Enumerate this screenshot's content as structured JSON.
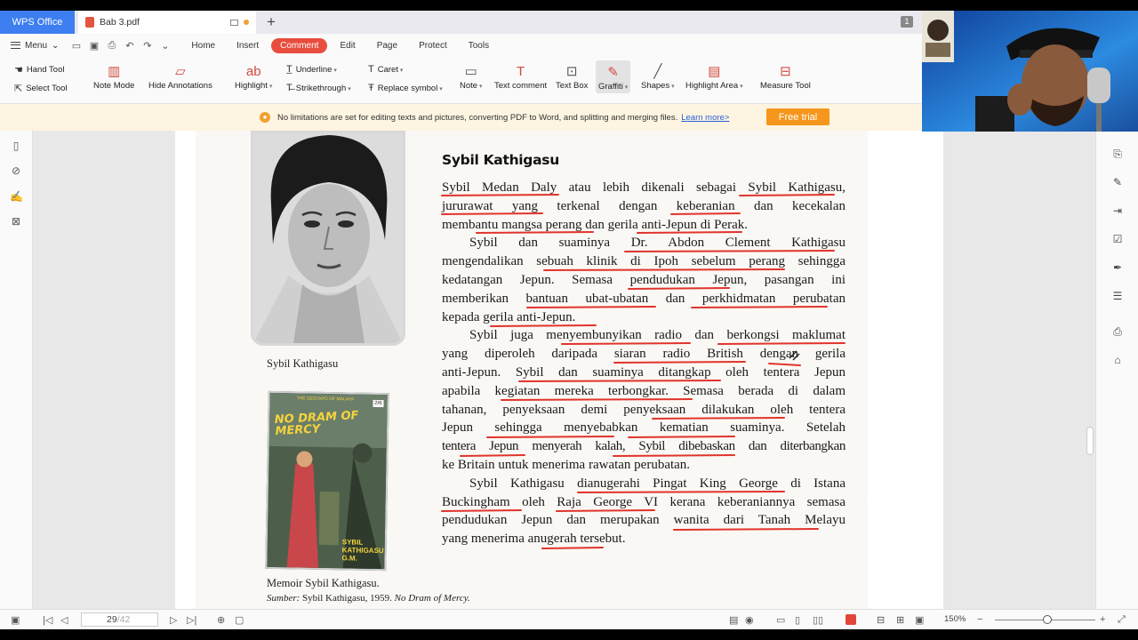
{
  "titlebar": {
    "app_tab": "WPS Office",
    "doc_tab": "Bab 3.pdf",
    "new_tab_glyph": "+",
    "window_count": "1"
  },
  "menubar": {
    "menu_label": "Menu",
    "tabs": [
      "Home",
      "Insert",
      "Comment",
      "Edit",
      "Page",
      "Protect",
      "Tools"
    ],
    "active_tab": "Comment"
  },
  "toolbar": {
    "hand_tool": "Hand Tool",
    "select_tool": "Select Tool",
    "note_mode": "Note Mode",
    "hide_annotations": "Hide Annotations",
    "highlight": "Highlight",
    "underline": "Underline",
    "strikethrough": "Strikethrough",
    "caret": "Caret",
    "replace_symbol": "Replace symbol",
    "note": "Note",
    "text_comment": "Text comment",
    "text_box": "Text Box",
    "graffiti": "Graffiti",
    "shapes": "Shapes",
    "highlight_area": "Highlight Area",
    "measure_tool": "Measure Tool"
  },
  "banner": {
    "message": "No limitations are set for editing texts and pictures, converting PDF to Word, and splitting and merging files.",
    "learn_more": "Learn more>",
    "cta": "Free trial"
  },
  "document": {
    "photo_caption": "Sybil Kathigasu",
    "book_cover": {
      "title": "NO DRAM OF MERCY",
      "author": "SYBIL KATHIGASU",
      "author_suffix": "G.M.",
      "tagline": "THE GESTAPO OF MALAYA",
      "price": "2/6"
    },
    "book_caption": "Memoir Sybil Kathigasu.",
    "source_prefix": "Sumber:",
    "source_rest": "Sybil Kathigasu, 1959.",
    "source_title": "No Dram of Mercy.",
    "article_title": "Sybil Kathigasu",
    "paragraphs": [
      [
        "Sybil Medan Daly atau lebih dikenali sebagai Sybil Kathigasu,",
        "jururawat yang terkenal dengan keberanian dan kecekalan",
        "membantu mangsa perang dan gerila anti-Jepun di Perak."
      ],
      [
        "Sybil dan suaminya Dr. Abdon Clement Kathigasu",
        "mengendalikan sebuah klinik di Ipoh sebelum perang sehingga",
        "kedatangan Jepun. Semasa pendudukan Jepun, pasangan ini",
        "memberikan bantuan ubat-ubatan dan perkhidmatan perubatan",
        "kepada gerila anti-Jepun."
      ],
      [
        "Sybil juga menyembunyikan radio dan berkongsi maklumat",
        "yang diperoleh daripada siaran radio British dengan gerila",
        "anti-Jepun. Sybil dan suaminya ditangkap oleh tentera Jepun",
        "apabila kegiatan mereka terbongkar. Semasa berada di dalam",
        "tahanan, penyeksaan demi penyeksaan dilakukan oleh tentera",
        "Jepun sehingga menyebabkan kematian suaminya. Setelah",
        "tentera Jepun menyerah kalah, Sybil dibebaskan dan diterbangkan",
        "ke Britain untuk menerima rawatan perubatan."
      ],
      [
        "Sybil Kathigasu dianugerahi Pingat King George di Istana",
        "Buckingham oleh Raja George VI kerana keberaniannya semasa",
        "pendudukan Jepun dan merupakan wanita dari Tanah Melayu",
        "yang menerima anugerah tersebut."
      ]
    ]
  },
  "statusbar": {
    "current_page": "29",
    "total_pages": "/42",
    "zoom": "150%"
  },
  "colors": {
    "accent_red": "#e84d3d",
    "wps_blue": "#3d7ef0",
    "cta_orange": "#f6961c",
    "underline_red": "#e0342c"
  },
  "icons": {
    "hand_tool": "hand-icon",
    "select_tool": "cursor-icon",
    "graffiti": "pen-icon",
    "shapes": "line-icon"
  }
}
